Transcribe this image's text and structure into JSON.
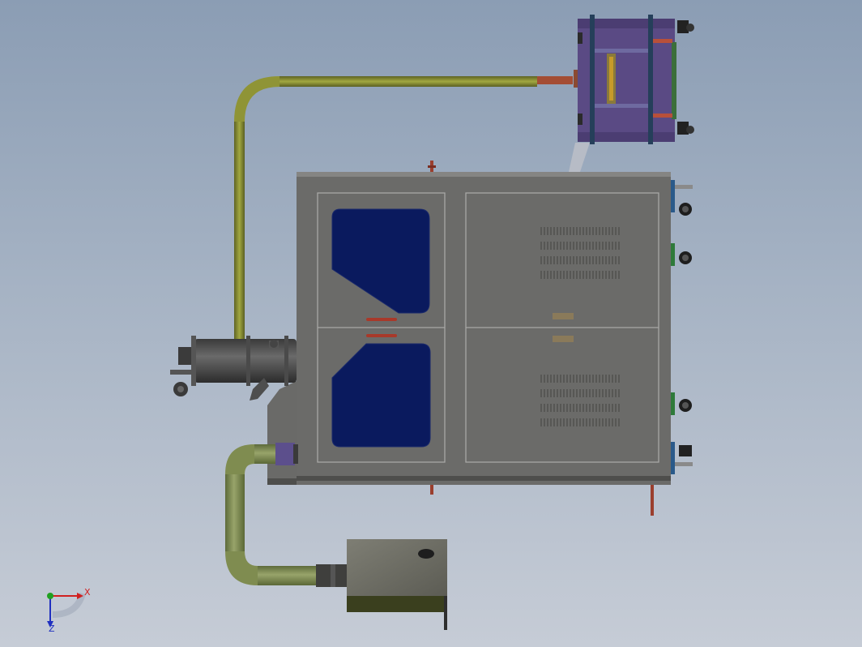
{
  "triad": {
    "x_label": "X",
    "z_label": "Z"
  }
}
